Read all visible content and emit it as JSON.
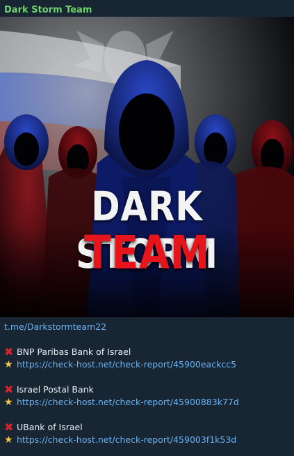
{
  "channel": {
    "name": "Dark Storm Team"
  },
  "poster": {
    "line1": "DARK STORM",
    "line2": "TEAM"
  },
  "post": {
    "channel_link": "t.me/Darkstormteam22",
    "entries": [
      {
        "target": "BNP Paribas Bank of Israel",
        "link": "https://check-host.net/check-report/45900eackcc5"
      },
      {
        "target": "Israel Postal Bank",
        "link": "https://check-host.net/check-report/45900883k77d"
      },
      {
        "target": "UBank of Israel",
        "link": "https://check-host.net/check-report/459003f1k53d"
      }
    ]
  },
  "icons": {
    "cross": "cross-mark-icon",
    "star": "glowing-star-icon"
  },
  "colors": {
    "channel_name": "#6fd26a",
    "link": "#6ab3f3",
    "background": "#182533",
    "poster_red": "#e8141c"
  }
}
